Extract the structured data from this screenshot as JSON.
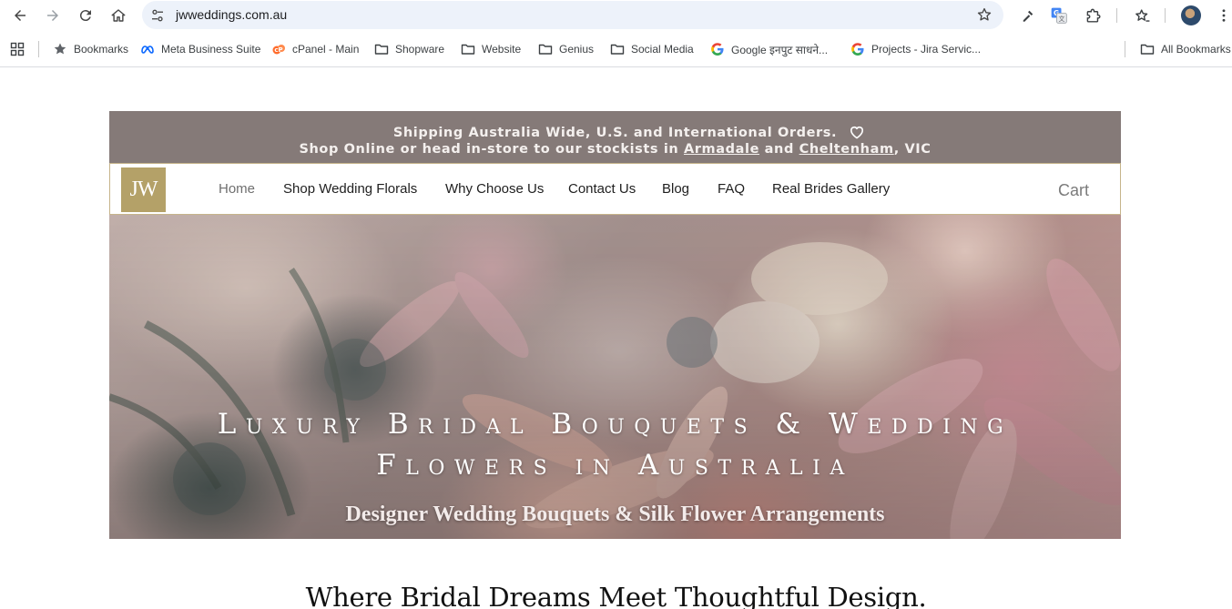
{
  "browser": {
    "url": "jwweddings.com.au",
    "bookmarks": [
      {
        "label": "Bookmarks",
        "icon": "star-icon"
      },
      {
        "label": "Meta Business Suite",
        "icon": "meta-icon"
      },
      {
        "label": "cPanel - Main",
        "icon": "cpanel-icon"
      },
      {
        "label": "Shopware",
        "icon": "folder-icon"
      },
      {
        "label": "Website",
        "icon": "folder-icon"
      },
      {
        "label": "Genius",
        "icon": "folder-icon"
      },
      {
        "label": "Social Media",
        "icon": "folder-icon"
      },
      {
        "label": "Google इनपुट साधने...",
        "icon": "google-icon"
      },
      {
        "label": "Projects - Jira Servic...",
        "icon": "google-icon"
      }
    ],
    "all_bookmarks": "All Bookmarks"
  },
  "site": {
    "announcement": {
      "line1": "Shipping Australia Wide, U.S. and International Orders.",
      "line2_prefix": "Shop Online or head in-store to our stockists in ",
      "link1": "Armadale",
      "line2_middle": " and ",
      "link2": "Cheltenham",
      "line2_suffix": ", VIC"
    },
    "logo": "JW",
    "nav": [
      {
        "label": "Home",
        "active": true
      },
      {
        "label": "Shop Wedding Florals"
      },
      {
        "label": "Why Choose Us"
      },
      {
        "label": "Contact Us"
      },
      {
        "label": "Blog"
      },
      {
        "label": "FAQ"
      },
      {
        "label": "Real Brides Gallery"
      }
    ],
    "cart": "Cart",
    "hero": {
      "title_line1": "Luxury Bridal Bouquets & Wedding",
      "title_line2": "Flowers in Australia",
      "subtitle": "Designer Wedding Bouquets & Silk Flower Arrangements"
    },
    "tagline": "Where Bridal Dreams Meet Thoughtful Design."
  },
  "colors": {
    "announcement_bg": "#857a78",
    "logo_bg": "#b4a168",
    "nav_border": "#c6b48a"
  }
}
